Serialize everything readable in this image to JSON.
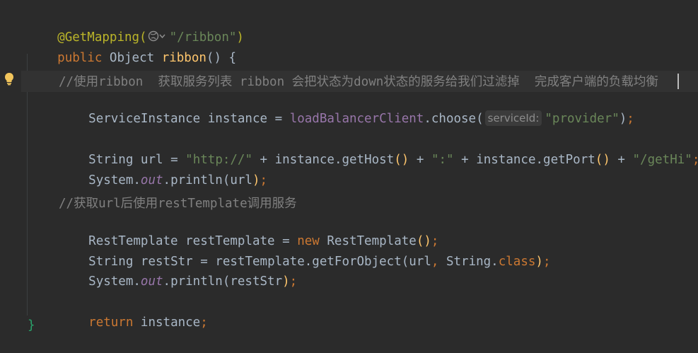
{
  "editor": {
    "line_annotation": "@GetMapping(",
    "line_annotation_path": "\"/ribbon\"",
    "line_annotation_close": ")",
    "kw_public": "public",
    "type_object": "Object",
    "method_name": "ribbon",
    "method_sig_rest": "() {",
    "comment_1": "//使用ribbon  获取服务列表 ribbon 会把状态为down状态的服务给我们过滤掉  完成客户端的负载均衡",
    "si_type": "ServiceInstance",
    "si_var": "instance",
    "eq": "=",
    "lb_client": "loadBalancerClient",
    "choose_call": ".choose(",
    "inlay_hint": "serviceId:",
    "provider_str": "\"provider\"",
    "close_paren_semi": ");",
    "string_type": "String",
    "url_var": "url",
    "http_str": "\"http://\"",
    "plus": "+",
    "instance_ref": "instance",
    "get_host": ".getHost",
    "colon_str": "\":\"",
    "get_port": ".getPort",
    "gethi_str": "\"/getHi\"",
    "semi": ";",
    "system": "System",
    "dot": ".",
    "out_field": "out",
    "println": ".println(",
    "comment_2": "//获取url后使用restTemplate调用服务",
    "rt_type": "RestTemplate",
    "rt_var": "restTemplate",
    "kw_new": "new",
    "rt_ctor": "RestTemplate",
    "ctor_parens": "()",
    "restStr_var": "restStr",
    "get_for_object": "restTemplate.getForObject(",
    "comma": ",",
    "string_class_prefix": "String.",
    "kw_class": "class",
    "close_paren": ")",
    "kw_return": "return",
    "close_brace": "}",
    "open_paren": "(",
    "parens_pair": "()"
  },
  "icons": {
    "bulb": "lightbulb-icon",
    "globe": "globe-dropdown-icon"
  },
  "colors": {
    "background": "#2b2b2b",
    "keyword": "#cc7832",
    "string": "#6a8759",
    "method": "#ffc66d",
    "field": "#9876aa",
    "comment": "#808080",
    "annotation": "#bbb529",
    "text": "#a9b7c6"
  }
}
